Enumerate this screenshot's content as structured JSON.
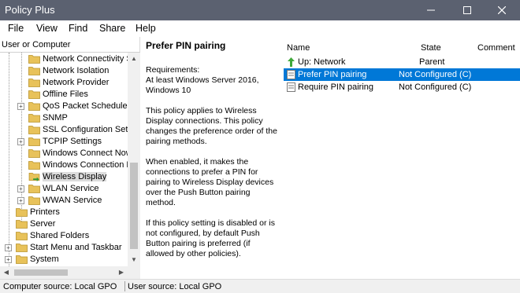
{
  "window": {
    "title": "Policy Plus",
    "title_bar_color": "#5b6170"
  },
  "menu": [
    "File",
    "View",
    "Find",
    "Share",
    "Help"
  ],
  "left_pane": {
    "header": "User or Computer",
    "tree": [
      {
        "label": "Network Connectivity S",
        "expander": "",
        "icon": "folder-icon"
      },
      {
        "label": "Network Isolation",
        "expander": "",
        "icon": "folder-icon"
      },
      {
        "label": "Network Provider",
        "expander": "",
        "icon": "folder-icon"
      },
      {
        "label": "Offline Files",
        "expander": "",
        "icon": "folder-icon"
      },
      {
        "label": "QoS Packet Scheduler",
        "expander": "+",
        "icon": "folder-icon"
      },
      {
        "label": "SNMP",
        "expander": "",
        "icon": "folder-icon"
      },
      {
        "label": "SSL Configuration Setti",
        "expander": "",
        "icon": "folder-icon"
      },
      {
        "label": "TCPIP Settings",
        "expander": "+",
        "icon": "folder-icon"
      },
      {
        "label": "Windows Connect Now",
        "expander": "",
        "icon": "folder-icon"
      },
      {
        "label": "Windows Connection M",
        "expander": "",
        "icon": "folder-icon"
      },
      {
        "label": "Wireless Display",
        "expander": "",
        "icon": "folder-open-arrow-icon",
        "selected": true
      },
      {
        "label": "WLAN Service",
        "expander": "+",
        "icon": "folder-icon"
      },
      {
        "label": "WWAN Service",
        "expander": "+",
        "icon": "folder-icon"
      },
      {
        "label": "Printers",
        "expander": "",
        "icon": "folder-icon"
      },
      {
        "label": "Server",
        "expander": "",
        "icon": "folder-icon"
      },
      {
        "label": "Shared Folders",
        "expander": "",
        "icon": "folder-icon"
      },
      {
        "label": "Start Menu and Taskbar",
        "expander": "+",
        "icon": "folder-icon"
      },
      {
        "label": "System",
        "expander": "+",
        "icon": "folder-icon"
      }
    ]
  },
  "description": {
    "title": "Prefer PIN pairing",
    "paragraphs": [
      "Requirements:\nAt least Windows Server 2016, Windows 10",
      "This policy applies to Wireless Display connections. This policy changes the preference order of the pairing methods.",
      "When enabled, it makes the connections to prefer a PIN for pairing to Wireless Display devices over the Push Button pairing method.",
      "If this policy setting is disabled or is not configured, by default Push Button pairing is preferred (if allowed by other policies)."
    ]
  },
  "list": {
    "columns": [
      "Name",
      "State",
      "Comment"
    ],
    "rows": [
      {
        "name": "Up: Network",
        "state": "Parent",
        "icon": "up-arrow-icon"
      },
      {
        "name": "Prefer PIN pairing",
        "state": "Not Configured (C)",
        "icon": "policy-icon",
        "selected": true
      },
      {
        "name": "Require PIN pairing",
        "state": "Not Configured (C)",
        "icon": "policy-icon"
      }
    ]
  },
  "status": {
    "computer_source": "Computer source:  Local GPO",
    "user_source": "User source:  Local GPO"
  },
  "colors": {
    "selection": "#0078d7",
    "folder": "#e8c25a"
  }
}
